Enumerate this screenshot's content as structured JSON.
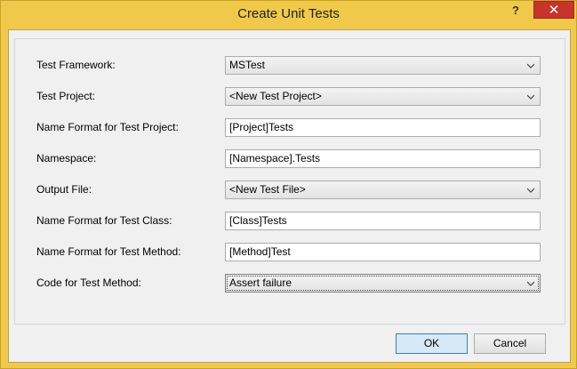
{
  "window": {
    "title": "Create Unit Tests",
    "help_glyph": "?",
    "close_glyph": "✕"
  },
  "fields": [
    {
      "label": "Test Framework:",
      "kind": "combo",
      "value": "MSTest"
    },
    {
      "label": "Test Project:",
      "kind": "combo",
      "value": "<New Test Project>"
    },
    {
      "label": "Name Format for Test Project:",
      "kind": "text",
      "value": "[Project]Tests"
    },
    {
      "label": "Namespace:",
      "kind": "text",
      "value": "[Namespace].Tests"
    },
    {
      "label": "Output File:",
      "kind": "combo",
      "value": "<New Test File>"
    },
    {
      "label": "Name Format for Test Class:",
      "kind": "text",
      "value": "[Class]Tests"
    },
    {
      "label": "Name Format for Test Method:",
      "kind": "text",
      "value": "[Method]Test"
    },
    {
      "label": "Code for Test Method:",
      "kind": "combo",
      "value": "Assert failure"
    }
  ],
  "buttons": {
    "ok": "OK",
    "cancel": "Cancel"
  },
  "icons": {
    "dropdown": "chevron-down-icon"
  }
}
